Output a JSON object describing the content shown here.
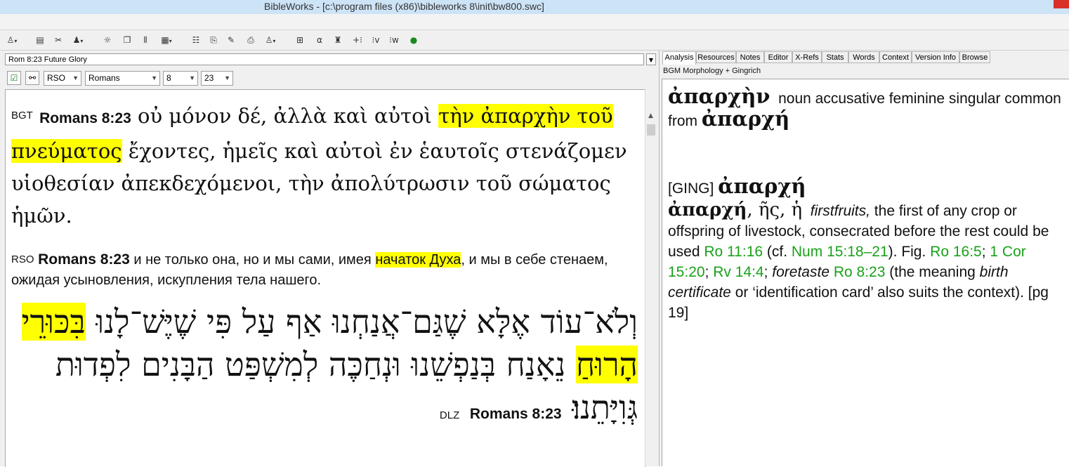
{
  "window": {
    "title": "BibleWorks - [c:\\program files (x86)\\bibleworks 8\\init\\bw800.swc]"
  },
  "toolbar": {
    "icons": [
      "search-options-icon",
      "browse-icon",
      "tools-icon",
      "person-icon",
      "highlight-icon",
      "windows-icon",
      "columns-icon",
      "grid-icon",
      "list-icon",
      "copy-icon",
      "edit-icon",
      "print-icon",
      "search-person-icon",
      "layout-icon",
      "alpha-icon",
      "user-icon",
      "plus-icon",
      "verse-icon",
      "word-icon",
      "globe-icon"
    ]
  },
  "left": {
    "verse_list_value": "Rom 8:23 Future Glory",
    "version_value": "RSO",
    "book_value": "Romans",
    "chapter_value": "8",
    "verse_value": "23",
    "greek": {
      "tag": "BGT",
      "ref": "Romans 8:23",
      "pre": "οὐ μόνον δέ, ἀλλὰ καὶ αὐτοὶ ",
      "highlight": "τὴν ἀπαρχὴν τοῦ πνεύματος",
      "post": " ἔχοντες, ἡμεῖς καὶ αὐτοὶ ἐν ἑαυτοῖς στενάζομεν υἱοθεσίαν ἀπεκδεχόμενοι, τὴν ἀπολύτρωσιν τοῦ σώματος ἡμῶν."
    },
    "russian": {
      "tag": "RSO",
      "ref": "Romans 8:23",
      "pre": " и не только она, но и мы сами, имея ",
      "highlight": "начаток Духа",
      "post": ", и мы в себе стенаем, ожидая усыновления, искупления тела нашего."
    },
    "hebrew": {
      "tag": "DLZ",
      "ref": "Romans 8:23",
      "pre": "וְלֹא־עוֹד אֶלָּא שֶׁגַּם־אֲנַחְנוּ אַף עַל פִּי שֶׁיֶּשׁ־לָנוּ ",
      "highlight": "בִּכּוּרֵי הָרוּחַ",
      "post": " נֵאָנַח בְּנַפְשֵׁנוּ וּנְחַכֶּה לְמִשְׁפַּט הַבָּנִים לִפְדוּת גְּוִיָּתֵנוּ׃"
    }
  },
  "right": {
    "tabs": [
      "Analysis",
      "Resources",
      "Notes",
      "Editor",
      "X-Refs",
      "Stats",
      "Words",
      "Context",
      "Version Info",
      "Browse"
    ],
    "active_tab": "Analysis",
    "subtitle": "BGM Morphology + Gingrich",
    "analysis": {
      "word": "ἀπαρχὴν",
      "parse": "noun accusative feminine singular common from",
      "lexical": "ἀπαρχή",
      "ging_tag": "[GING]",
      "ging_lemma": "ἀπαρχή",
      "entry_lemma": "ἀπαρχή",
      "entry_forms": ", ῆς, ἡ",
      "gloss1": "firstfruits,",
      "def1": " the first of any crop or offspring of livestock, consecrated before the rest could be used ",
      "ref1": "Ro 11:16",
      "cf_open": " (cf. ",
      "ref2": "Num 15:18–21",
      "fig": "). Fig. ",
      "ref3": "Ro 16:5",
      "sep1": "; ",
      "ref4": "1 Cor 15:20",
      "sep2": "; ",
      "ref5": "Rv 14:4",
      "sep3": "; ",
      "gloss2": "foretaste",
      "space": " ",
      "ref6": "Ro 8:23",
      "def2a": " (the meaning ",
      "gloss3": "birth certificate",
      "def2b": " or ‘identification card’ also suits the context). [pg 19]"
    }
  }
}
